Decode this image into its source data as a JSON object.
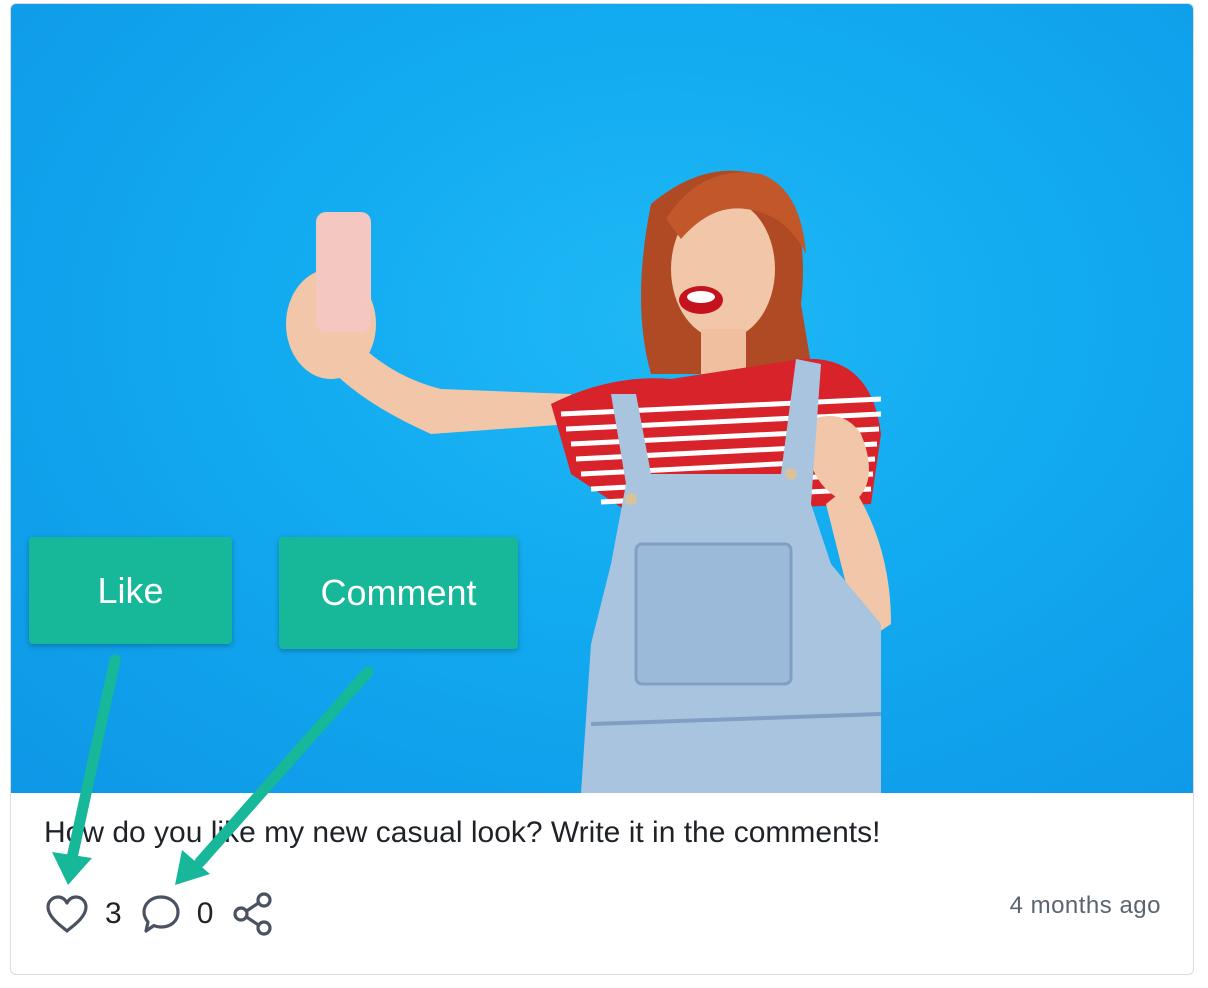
{
  "post": {
    "caption": "How do you like my new casual look? Write it in the comments!",
    "timestamp": "4 months ago",
    "like_count": "3",
    "comment_count": "0",
    "image_background": "#12aaf0"
  },
  "callouts": {
    "like_label": "Like",
    "comment_label": "Comment",
    "color": "#17b799"
  },
  "icons": {
    "like": "heart-icon",
    "comment": "comment-bubble-icon",
    "share": "share-icon"
  }
}
